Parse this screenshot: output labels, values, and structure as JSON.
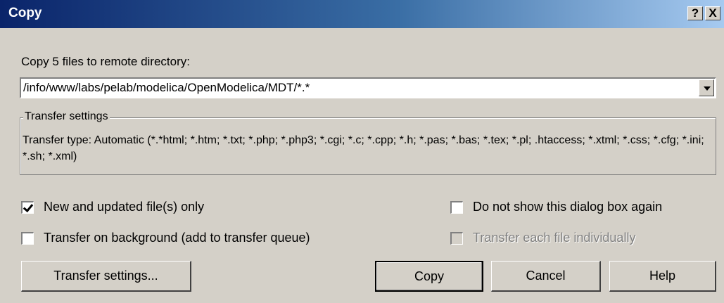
{
  "window": {
    "title": "Copy",
    "help_button": "?",
    "close_button": "X"
  },
  "prompt": "Copy 5 files to remote directory:",
  "directory": {
    "value": "/info/www/labs/pelab/modelica/OpenModelica/MDT/*.*"
  },
  "transfer_group": {
    "label": "Transfer settings",
    "text": "Transfer type: Automatic (*.*html; *.htm; *.txt; *.php; *.php3; *.cgi; *.c; *.cpp; *.h; *.pas; *.bas; *.tex; *.pl; .htaccess; *.xtml; *.css; *.cfg; *.ini; *.sh; *.xml)"
  },
  "options": {
    "new_updated": {
      "label": "New and updated file(s) only",
      "checked": true
    },
    "background": {
      "label": "Transfer on background (add to transfer queue)",
      "checked": false
    },
    "dont_show": {
      "label": "Do not show this dialog box again",
      "checked": false
    },
    "individually": {
      "label": "Transfer each file individually",
      "checked": false,
      "disabled": true
    }
  },
  "buttons": {
    "transfer_settings": "Transfer settings...",
    "copy": "Copy",
    "cancel": "Cancel",
    "help": "Help"
  }
}
